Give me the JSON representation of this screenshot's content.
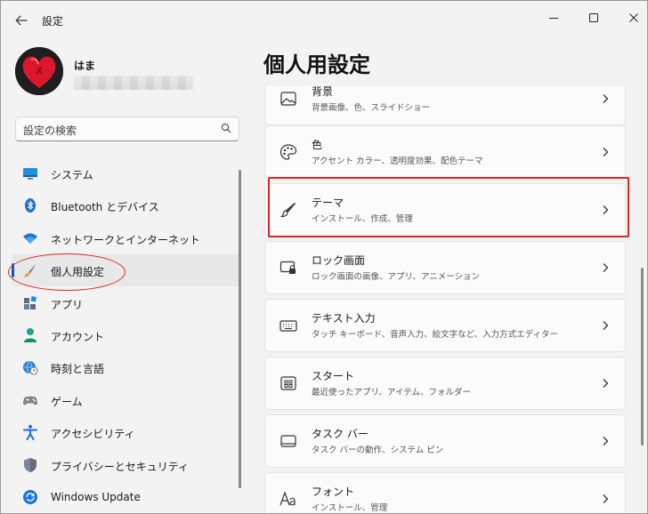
{
  "window": {
    "title": "設定"
  },
  "profile": {
    "name": "はま"
  },
  "search": {
    "placeholder": "設定の検索"
  },
  "nav": {
    "items": [
      {
        "label": "システム",
        "icon": "monitor-icon"
      },
      {
        "label": "Bluetooth とデバイス",
        "icon": "bluetooth-icon"
      },
      {
        "label": "ネットワークとインターネット",
        "icon": "wifi-icon"
      },
      {
        "label": "個人用設定",
        "icon": "paintbrush-icon",
        "active": true
      },
      {
        "label": "アプリ",
        "icon": "apps-icon"
      },
      {
        "label": "アカウント",
        "icon": "person-icon"
      },
      {
        "label": "時刻と言語",
        "icon": "globe-clock-icon"
      },
      {
        "label": "ゲーム",
        "icon": "gamepad-icon"
      },
      {
        "label": "アクセシビリティ",
        "icon": "accessibility-icon"
      },
      {
        "label": "プライバシーとセキュリティ",
        "icon": "shield-icon"
      },
      {
        "label": "Windows Update",
        "icon": "update-icon"
      }
    ]
  },
  "main": {
    "title": "個人用設定",
    "cards": [
      {
        "title": "背景",
        "subtitle": "背景画像、色、スライドショー",
        "icon": "image-icon"
      },
      {
        "title": "色",
        "subtitle": "アクセント カラー、透明度効果、配色テーマ",
        "icon": "palette-icon"
      },
      {
        "title": "テーマ",
        "subtitle": "インストール、作成、管理",
        "icon": "brush-icon"
      },
      {
        "title": "ロック画面",
        "subtitle": "ロック画面の画像、アプリ、アニメーション",
        "icon": "lock-screen-icon"
      },
      {
        "title": "テキスト入力",
        "subtitle": "タッチ キーボード、音声入力、絵文字など、入力方式エディター",
        "icon": "keyboard-icon"
      },
      {
        "title": "スタート",
        "subtitle": "最近使ったアプリ、アイテム、フォルダー",
        "icon": "start-icon"
      },
      {
        "title": "タスク バー",
        "subtitle": "タスク バーの動作、システム ピン",
        "icon": "taskbar-icon"
      },
      {
        "title": "フォント",
        "subtitle": "インストール、管理",
        "icon": "font-icon"
      }
    ]
  },
  "colors": {
    "accent": "#005fb8",
    "highlight": "#e02424"
  }
}
